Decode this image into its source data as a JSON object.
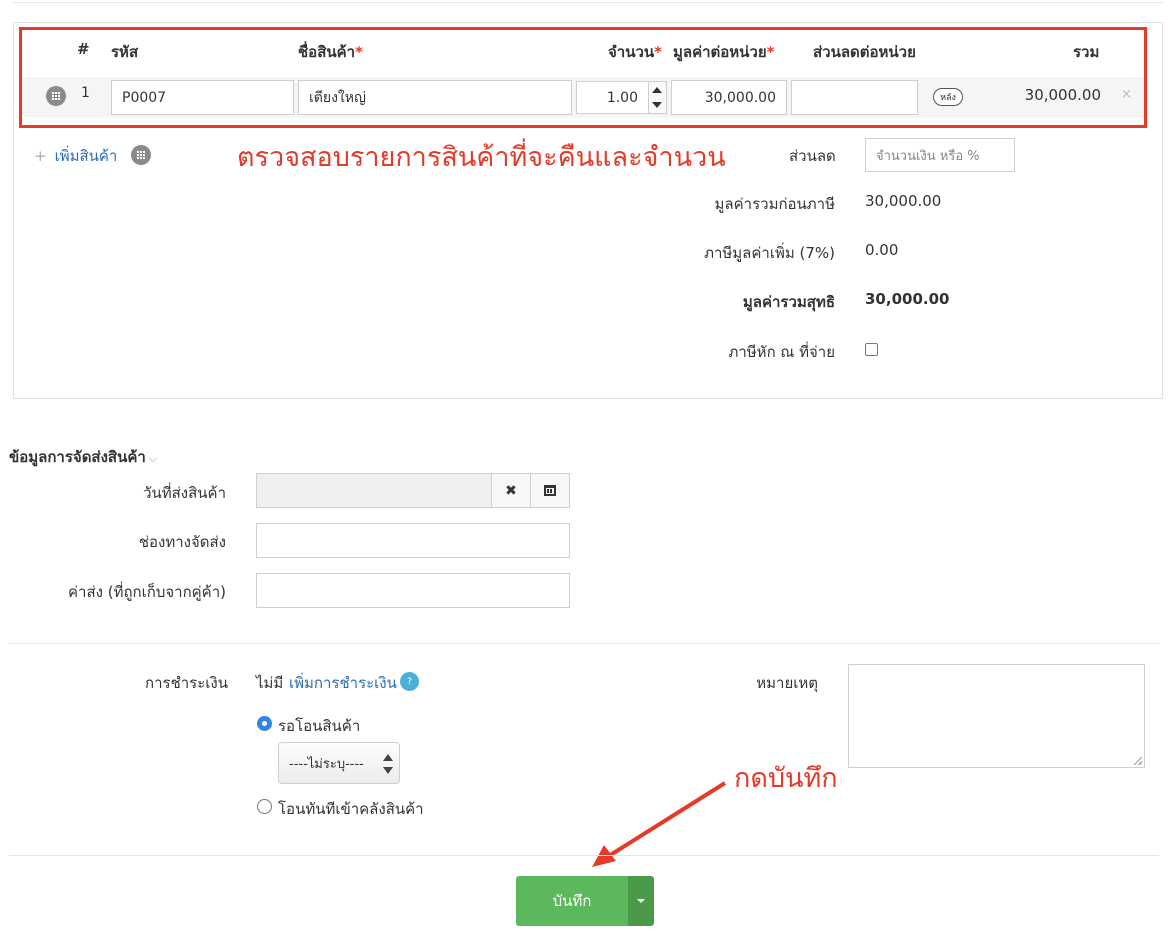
{
  "items_table": {
    "headers": {
      "index": "#",
      "code": "รหัส",
      "name": "ชื่อสินค้า",
      "qty": "จำนวน",
      "unit_price": "มูลค่าต่อหน่วย",
      "discount": "ส่วนลดต่อหน่วย",
      "total": "รวม",
      "required_mark": "*"
    },
    "rows": [
      {
        "index": "1",
        "code": "P0007",
        "name": "เตียงใหญ่",
        "qty": "1.00",
        "unit_price": "30,000.00",
        "discount": "",
        "discount_toggle": "หลัง",
        "total": "30,000.00",
        "remove": "×"
      }
    ],
    "add_item_plus": "+",
    "add_item_label": "เพิ่มสินค้า"
  },
  "annotations": {
    "check_items": "ตรวจสอบรายการสินค้าที่จะคืนและจำนวน",
    "press_save": "กดบันทึก",
    "highlight_color": "#e53a28"
  },
  "summary": {
    "discount_label": "ส่วนลด",
    "discount_placeholder": "จำนวนเงิน หรือ %",
    "subtotal_label": "มูลค่ารวมก่อนภาษี",
    "subtotal_value": "30,000.00",
    "vat_label": "ภาษีมูลค่าเพิ่ม (7%)",
    "vat_value": "0.00",
    "net_label": "มูลค่ารวมสุทธิ",
    "net_value": "30,000.00",
    "withholding_label": "ภาษีหัก ณ ที่จ่าย"
  },
  "shipping": {
    "section_title": "ข้อมูลการจัดส่งสินค้า",
    "ship_date_label": "วันที่ส่งสินค้า",
    "channel_label": "ช่องทางจัดส่ง",
    "fee_label": "ค่าส่ง (ที่ถูกเก็บจากคู่ค้า)"
  },
  "payment": {
    "label": "การชำระเงิน",
    "none": "ไม่มี",
    "add_payment": "เพิ่มการชำระเงิน",
    "help": "?",
    "option_wait": "รอโอนสินค้า",
    "select_value": "----ไม่ระบุ----",
    "option_immediate": "โอนทันทีเข้าคลังสินค้า",
    "notes_label": "หมายเหตุ"
  },
  "actions": {
    "save_label": "บันทึก",
    "accent_color": "#5cb85c"
  }
}
